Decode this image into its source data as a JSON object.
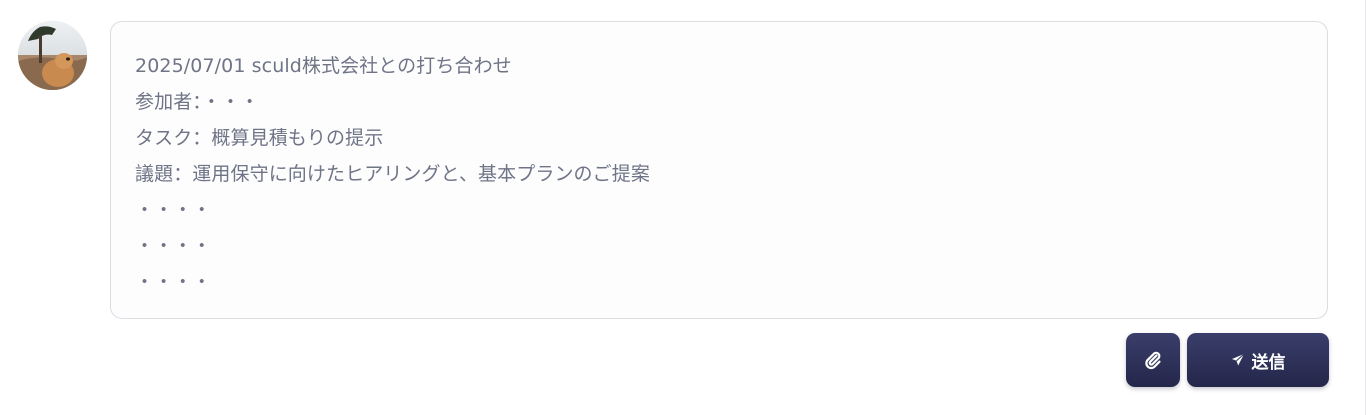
{
  "message": {
    "lines": [
      "2025/07/01 sculd株式会社との打ち合わせ",
      "参加者：・・・",
      "タスク：概算見積もりの提示",
      "議題：運用保守に向けたヒアリングと、基本プランのご提案",
      "・・・・",
      "・・・・",
      "・・・・"
    ]
  },
  "actions": {
    "attach_icon": "paperclip-icon",
    "send_icon": "paper-plane-icon",
    "send_label": "送信"
  },
  "colors": {
    "button_bg": "#2e3159",
    "text_muted": "#6f7486",
    "border": "#dcdde3"
  }
}
